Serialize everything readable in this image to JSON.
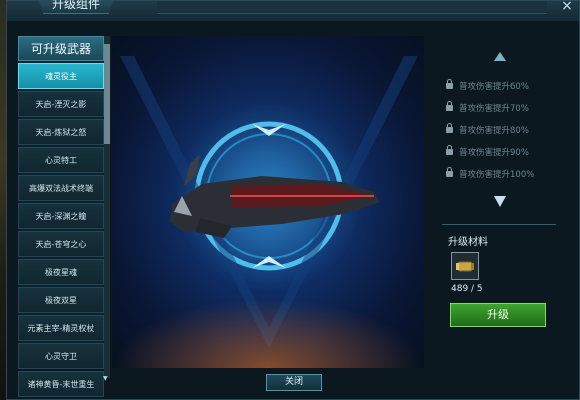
{
  "window": {
    "title": "升级组件",
    "close_glyph": "×"
  },
  "sidebar": {
    "header": "可升级武器",
    "items": [
      {
        "label": "魂灵役主",
        "active": true
      },
      {
        "label": "天启-湮灭之影",
        "active": false
      },
      {
        "label": "天启-炼狱之怒",
        "active": false
      },
      {
        "label": "心灵特工",
        "active": false
      },
      {
        "label": "高爆双法战术终端",
        "active": false
      },
      {
        "label": "天启-深渊之瞳",
        "active": false
      },
      {
        "label": "天启-苍穹之心",
        "active": false
      },
      {
        "label": "极夜星魂",
        "active": false
      },
      {
        "label": "极夜双星",
        "active": false
      },
      {
        "label": "元素主宰-精灵权杖",
        "active": false
      },
      {
        "label": "心灵守卫",
        "active": false
      },
      {
        "label": "诸神黄昏-末世重生",
        "active": false
      }
    ]
  },
  "attributes": [
    {
      "label": "普攻伤害提升60%",
      "locked": true
    },
    {
      "label": "普攻伤害提升70%",
      "locked": true
    },
    {
      "label": "普攻伤害提升80%",
      "locked": true
    },
    {
      "label": "普攻伤害提升90%",
      "locked": true
    },
    {
      "label": "普攻伤害提升100%",
      "locked": true
    }
  ],
  "materials": {
    "title": "升级材料",
    "count": "489 / 5",
    "icon": "ammo-shell-icon"
  },
  "buttons": {
    "upgrade": "升级",
    "close": "关闭"
  },
  "colors": {
    "accent": "#27b7cf",
    "upgrade_green": "#3ea52f",
    "stage_blue": "#1a5aa8"
  }
}
